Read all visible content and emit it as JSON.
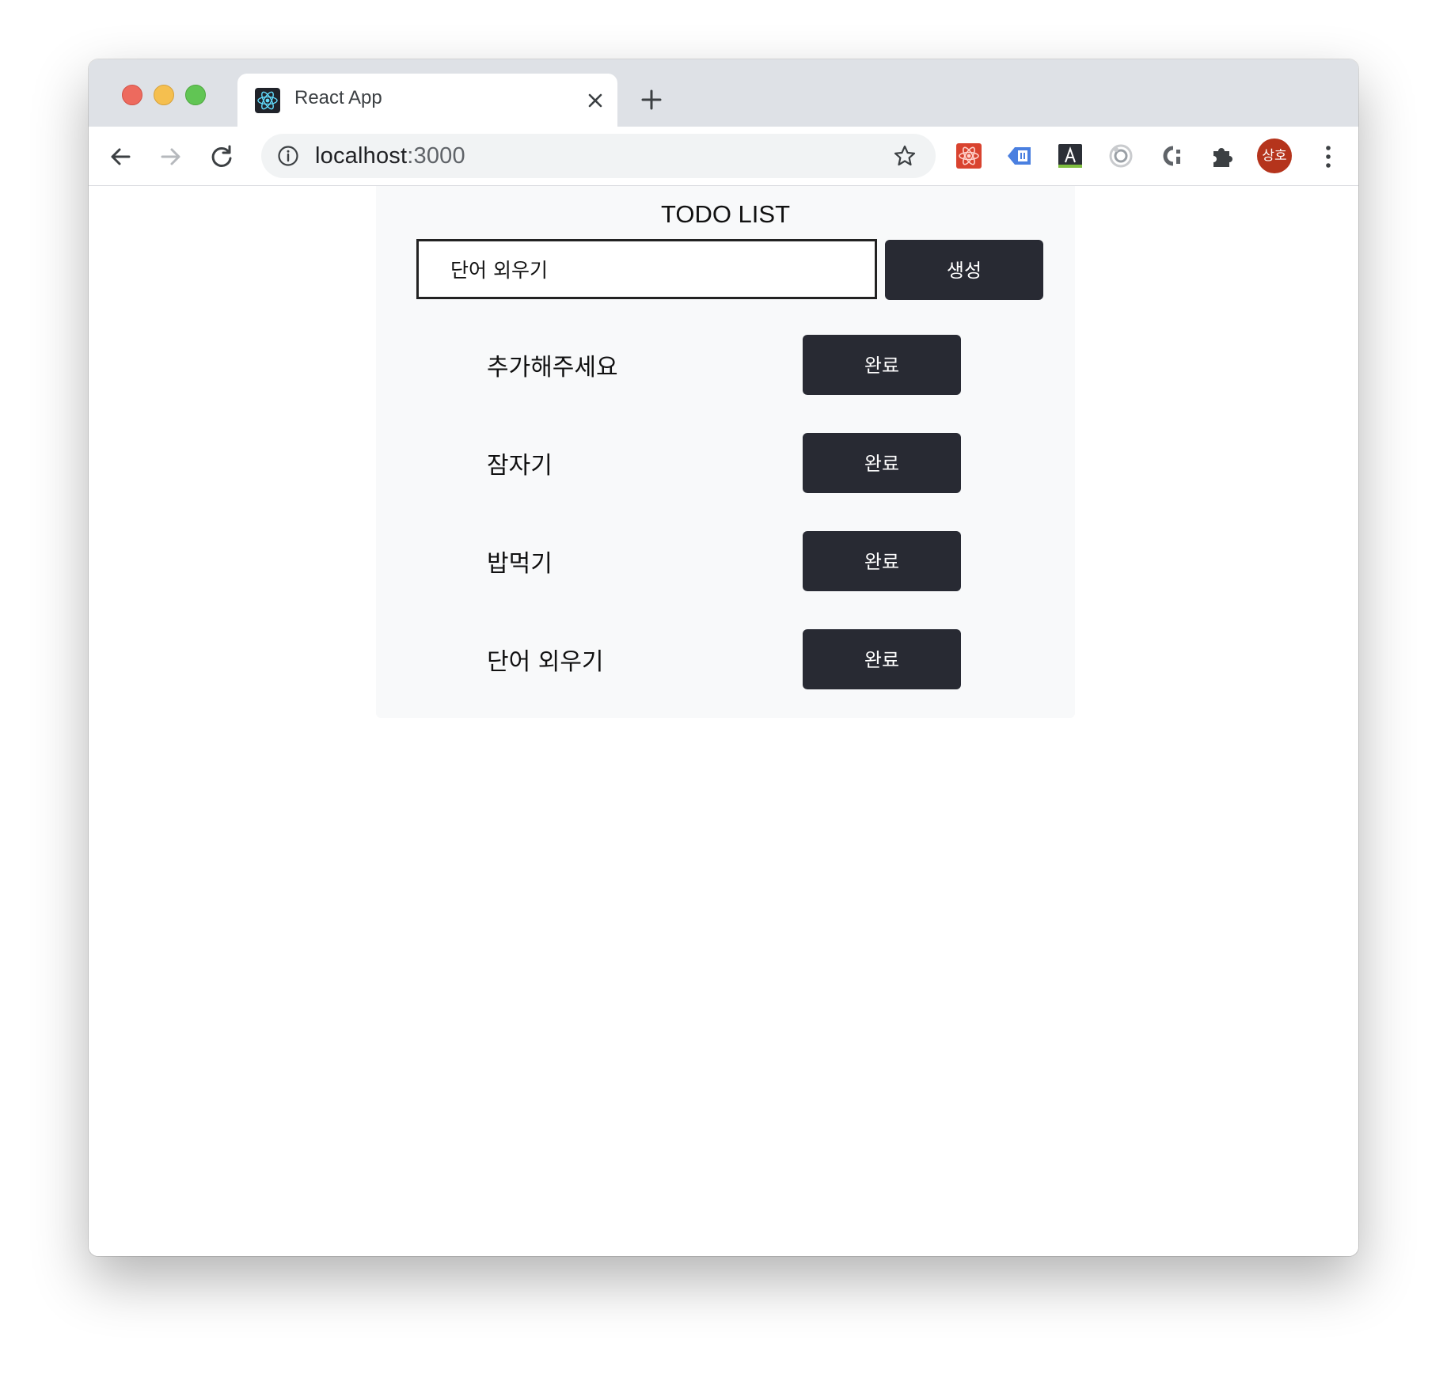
{
  "browser": {
    "tab": {
      "title": "React App",
      "favicon": "react-logo-icon",
      "close_icon": "close-icon"
    },
    "new_tab_icon": "plus-icon",
    "nav": {
      "back_icon": "arrow-left-icon",
      "forward_icon": "arrow-right-icon",
      "reload_icon": "reload-icon"
    },
    "address": {
      "host": "localhost",
      "port": ":3000",
      "info_icon": "info-icon",
      "bookmark_icon": "star-icon"
    },
    "extensions": [
      "react-devtools-icon",
      "tag-extension-icon",
      "font-a-extension-icon",
      "circle-extension-icon",
      "ci-extension-icon",
      "puzzle-extensions-icon"
    ],
    "profile": {
      "label": "상호",
      "color": "#b5341c"
    },
    "menu_icon": "three-dots-vertical-icon"
  },
  "todo": {
    "title": "TODO LIST",
    "input": {
      "value": "단어 외우기",
      "placeholder": ""
    },
    "create_label": "생성",
    "items": [
      {
        "text": "추가해주세요",
        "button": "완료"
      },
      {
        "text": "잠자기",
        "button": "완료"
      },
      {
        "text": "밥먹기",
        "button": "완료"
      },
      {
        "text": "단어 외우기",
        "button": "완료"
      }
    ]
  },
  "colors": {
    "button_bg": "#282a33",
    "card_bg": "#f8f9fa",
    "tabstrip_bg": "#dee1e6"
  }
}
